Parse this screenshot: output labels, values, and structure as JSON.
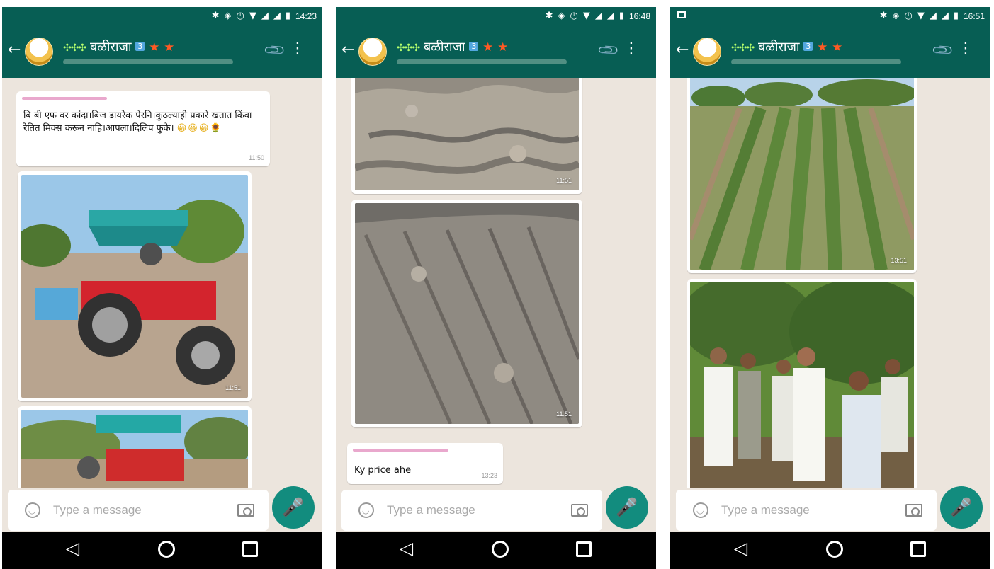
{
  "common": {
    "group_name": "बळीराजा",
    "badge": "3",
    "star_icon": "★",
    "placeholder": "Type a message",
    "back_icon": "←",
    "attach_icon": "📎",
    "menu_icon": "⋮",
    "mic_icon": "🎤",
    "nav_back_icon": "◁"
  },
  "phones": [
    {
      "time": "14:23",
      "messages": {
        "text": "बि बी एफ वर कांदा।बिज डायरेक पेरनि।कुठल्याही प्रकारे खतात किंवा रेतित मिक्स करून नाहि।आपला।दिलिप फुके।",
        "emoji": "😀😀😀🌻",
        "text_time": "11:50",
        "photo1_time": "11:51"
      }
    },
    {
      "time": "16:48",
      "messages": {
        "photo1_time": "11:51",
        "photo2_time": "11:51",
        "text": "Ky price ahe",
        "text_time": "13:23"
      }
    },
    {
      "time": "16:51",
      "messages": {
        "photo1_time": "13:51"
      }
    }
  ]
}
